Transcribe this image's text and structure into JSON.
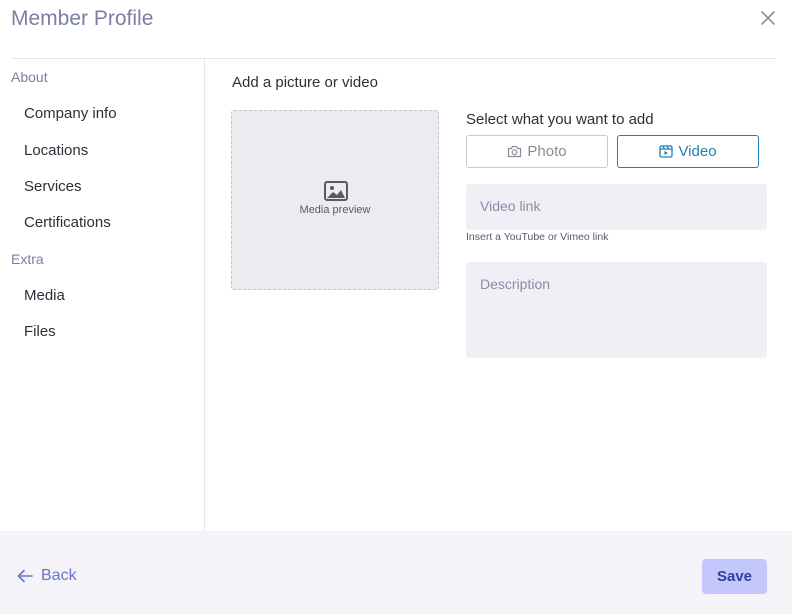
{
  "header": {
    "title": "Member Profile"
  },
  "sidebar": {
    "sections": [
      {
        "title": "About",
        "items": [
          "Company info",
          "Locations",
          "Services",
          "Certifications"
        ]
      },
      {
        "title": "Extra",
        "items": [
          "Media",
          "Files"
        ]
      }
    ]
  },
  "main": {
    "add_label": "Add a picture or video",
    "media_preview_text": "Media preview",
    "select_label": "Select what you want to add",
    "toggle": {
      "photo": "Photo",
      "video": "Video",
      "selected": "Video"
    },
    "video_link": {
      "placeholder": "Video link",
      "hint": "Insert a YouTube or Vimeo link"
    },
    "description": {
      "placeholder": "Description"
    }
  },
  "footer": {
    "back_label": "Back",
    "save_label": "Save"
  },
  "colors": {
    "accent": "#1f7fb8",
    "title": "#7a7fa3",
    "save_bg": "#c4c7fb",
    "back": "#6b74c9"
  }
}
